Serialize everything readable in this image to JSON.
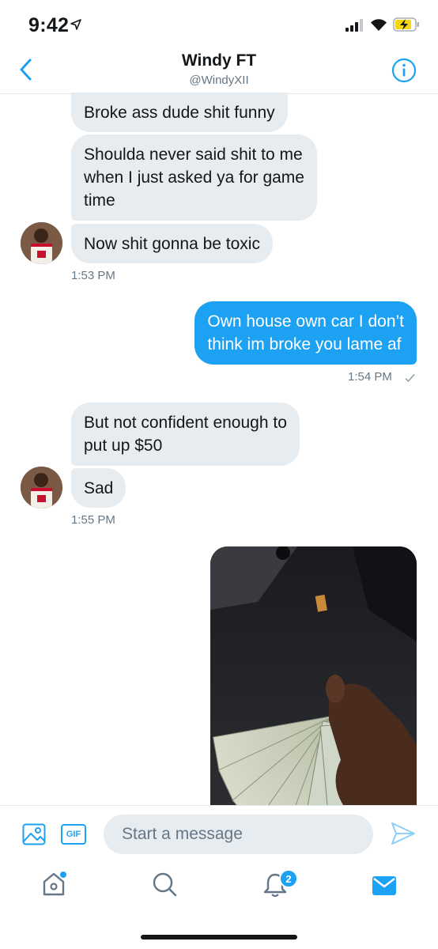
{
  "status_bar": {
    "time": "9:42"
  },
  "header": {
    "name": "Windy FT",
    "handle": "@WindyXII"
  },
  "messages": {
    "m1": "Broke ass dude shit funny",
    "m2_l1": "Shoulda never said shit to me",
    "m2_l2": "when I just asked ya for game",
    "m2_l3": "time",
    "m3": "Now shit gonna be toxic",
    "t1": "1:53 PM",
    "m4_l1": "Own house own car I don’t",
    "m4_l2": "think im broke you lame af",
    "t2": "1:54 PM",
    "m5_l1": "But not confident enough to",
    "m5_l2": "put up $50",
    "m6": "Sad",
    "t3": "1:55 PM"
  },
  "composer": {
    "placeholder": "Start a message",
    "gif_label": "GIF"
  },
  "tabbar": {
    "notifications_badge": "2"
  },
  "colors": {
    "accent": "#1da1f2",
    "incoming_bubble": "#e6ecf0",
    "secondary_text": "#657786"
  },
  "icons": [
    "location-arrow-icon",
    "signal-icon",
    "wifi-icon",
    "battery-charging-icon",
    "back-chevron-icon",
    "info-icon",
    "image-icon",
    "send-icon",
    "home-icon",
    "search-icon",
    "bell-icon",
    "mail-icon",
    "read-check-icon"
  ]
}
